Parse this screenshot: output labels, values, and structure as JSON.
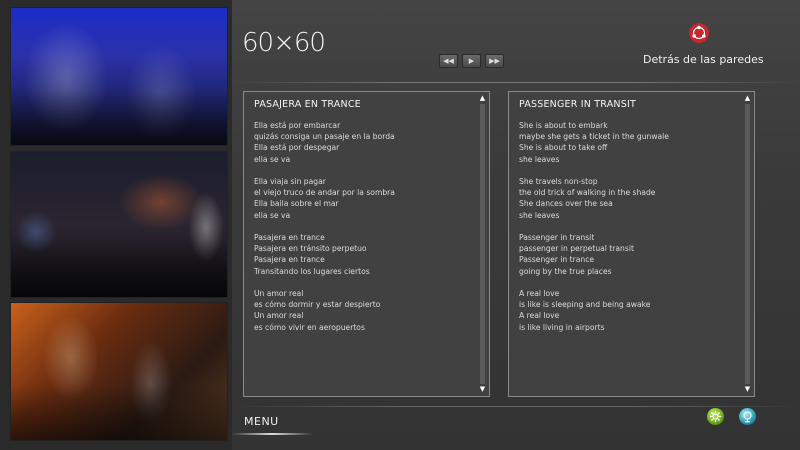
{
  "logo": {
    "text": "60×60"
  },
  "brand": {
    "name": "Detrás de las paredes",
    "icon": "red-circle-emblem-icon",
    "color": "#c8262c"
  },
  "player_controls": [
    {
      "name": "rewind",
      "glyph": "◀◀"
    },
    {
      "name": "play",
      "glyph": "▶"
    },
    {
      "name": "fast-forward",
      "glyph": "▶▶"
    }
  ],
  "lyrics_original": {
    "title": "PASAJERA EN TRANCE",
    "stanzas": [
      [
        "Ella está por embarcar",
        "quizás consiga un pasaje en la borda",
        "Ella está por despegar",
        "ella se va"
      ],
      [
        "Ella viaja sin pagar",
        "el viejo truco de andar por la sombra",
        "Ella baila sobre el mar",
        "ella se va"
      ],
      [
        "Pasajera en trance",
        "Pasajera en tránsito perpetuo",
        "Pasajera en trance",
        "Transitando los lugares ciertos"
      ],
      [
        "Un amor real",
        "es cómo dormir y estar despierto",
        "Un amor real",
        "es cómo vivir en aeropuertos"
      ]
    ]
  },
  "lyrics_translation": {
    "title": "PASSENGER IN TRANSIT",
    "stanzas": [
      [
        "She is about to embark",
        "maybe she gets a ticket in the gunwale",
        "She is about to take off",
        "she leaves"
      ],
      [
        "She travels non-stop",
        "the old trick of walking in the shade",
        "She dances over the sea",
        "she leaves"
      ],
      [
        "Passenger in transit",
        "passenger in perpetual transit",
        "Passenger in trance",
        "going by the true places"
      ],
      [
        "A real love",
        "is like is sleeping and being awake",
        "A real love",
        "is like living in airports"
      ]
    ]
  },
  "scroll": {
    "up": "▲",
    "down": "▼"
  },
  "footer": {
    "menu_label": "MENU",
    "buttons": [
      {
        "icon": "green-gear-icon",
        "color": "#5a9a10"
      },
      {
        "icon": "teal-globe-icon",
        "color": "#1c8aa0"
      }
    ]
  }
}
